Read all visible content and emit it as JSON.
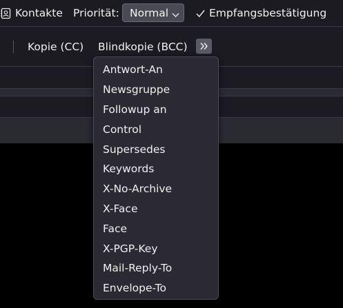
{
  "toolbar": {
    "contacts_label": "Kontakte",
    "priority_label": "Priorität:",
    "priority_value": "Normal",
    "return_receipt_label": "Empfangsbestätigung"
  },
  "address_bar": {
    "cc_label": "Kopie (CC)",
    "bcc_label": "Blindkopie (BCC)"
  },
  "header_menu": {
    "items": [
      "Antwort-An",
      "Newsgruppe",
      "Followup an",
      "Control",
      "Supersedes",
      "Keywords",
      "X-No-Archive",
      "X-Face",
      "Face",
      "X-PGP-Key",
      "Mail-Reply-To",
      "Envelope-To"
    ]
  },
  "icons": {
    "contacts": "address-book-icon",
    "priority_dropdown": "chevron-down-icon",
    "return_receipt": "checkmark-icon",
    "more_headers": "double-chevron-right-icon"
  },
  "colors": {
    "background": "#1c1b22",
    "menu_background": "#2b2a33",
    "select_background": "#4a4a52",
    "text": "#f0f0f0"
  }
}
